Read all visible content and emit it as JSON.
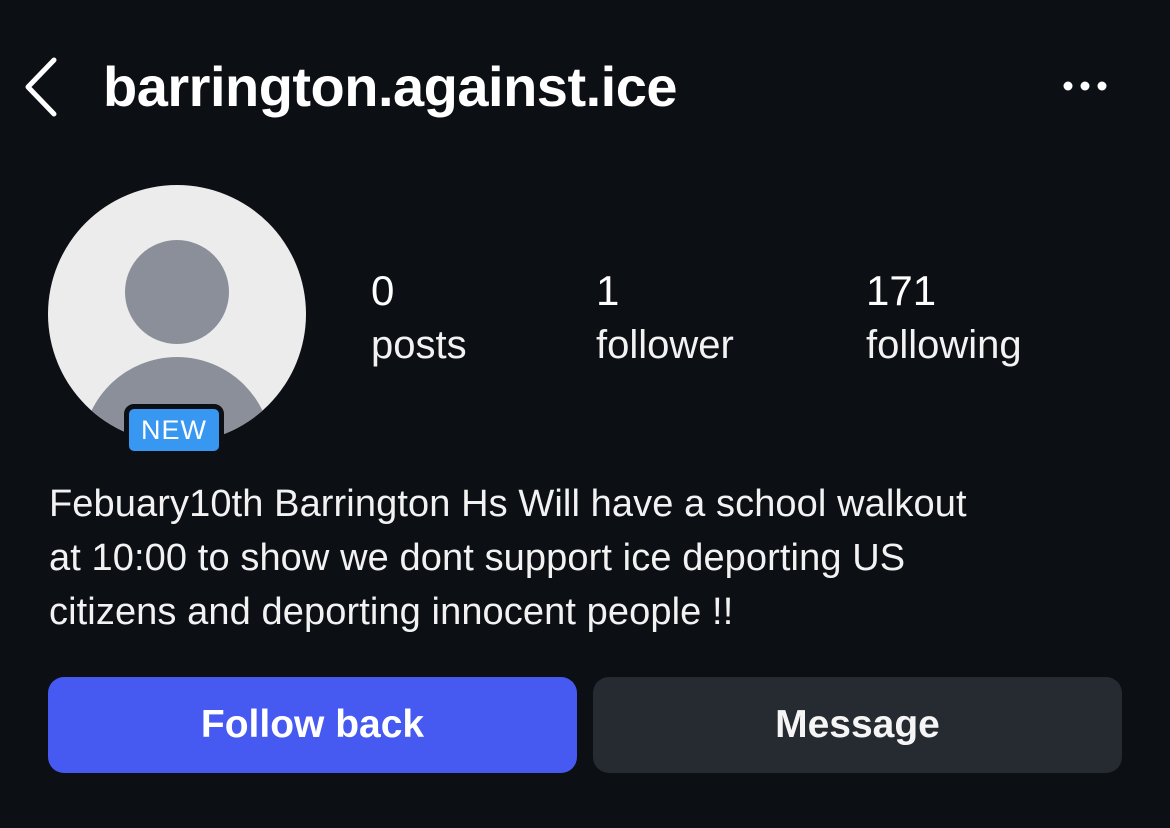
{
  "header": {
    "username": "barrington.against.ice",
    "back_icon": "chevron-left-icon",
    "more_icon": "more-horizontal-icon"
  },
  "profile": {
    "avatar_icon": "default-avatar-icon",
    "badge": "NEW",
    "badge_color": "#3897f0"
  },
  "stats": {
    "posts": {
      "count": "0",
      "label": "posts"
    },
    "followers": {
      "count": "1",
      "label": "follower"
    },
    "following": {
      "count": "171",
      "label": "following"
    }
  },
  "bio": {
    "lines": [
      "Febuary10th Barrington Hs Will have a school walkout",
      "at 10:00 to show we dont support ice deporting US",
      "citizens and deporting innocent people !!"
    ]
  },
  "actions": {
    "follow_back_label": "Follow back",
    "message_label": "Message",
    "follow_back_color": "#4659f0",
    "message_color": "#262a31"
  }
}
